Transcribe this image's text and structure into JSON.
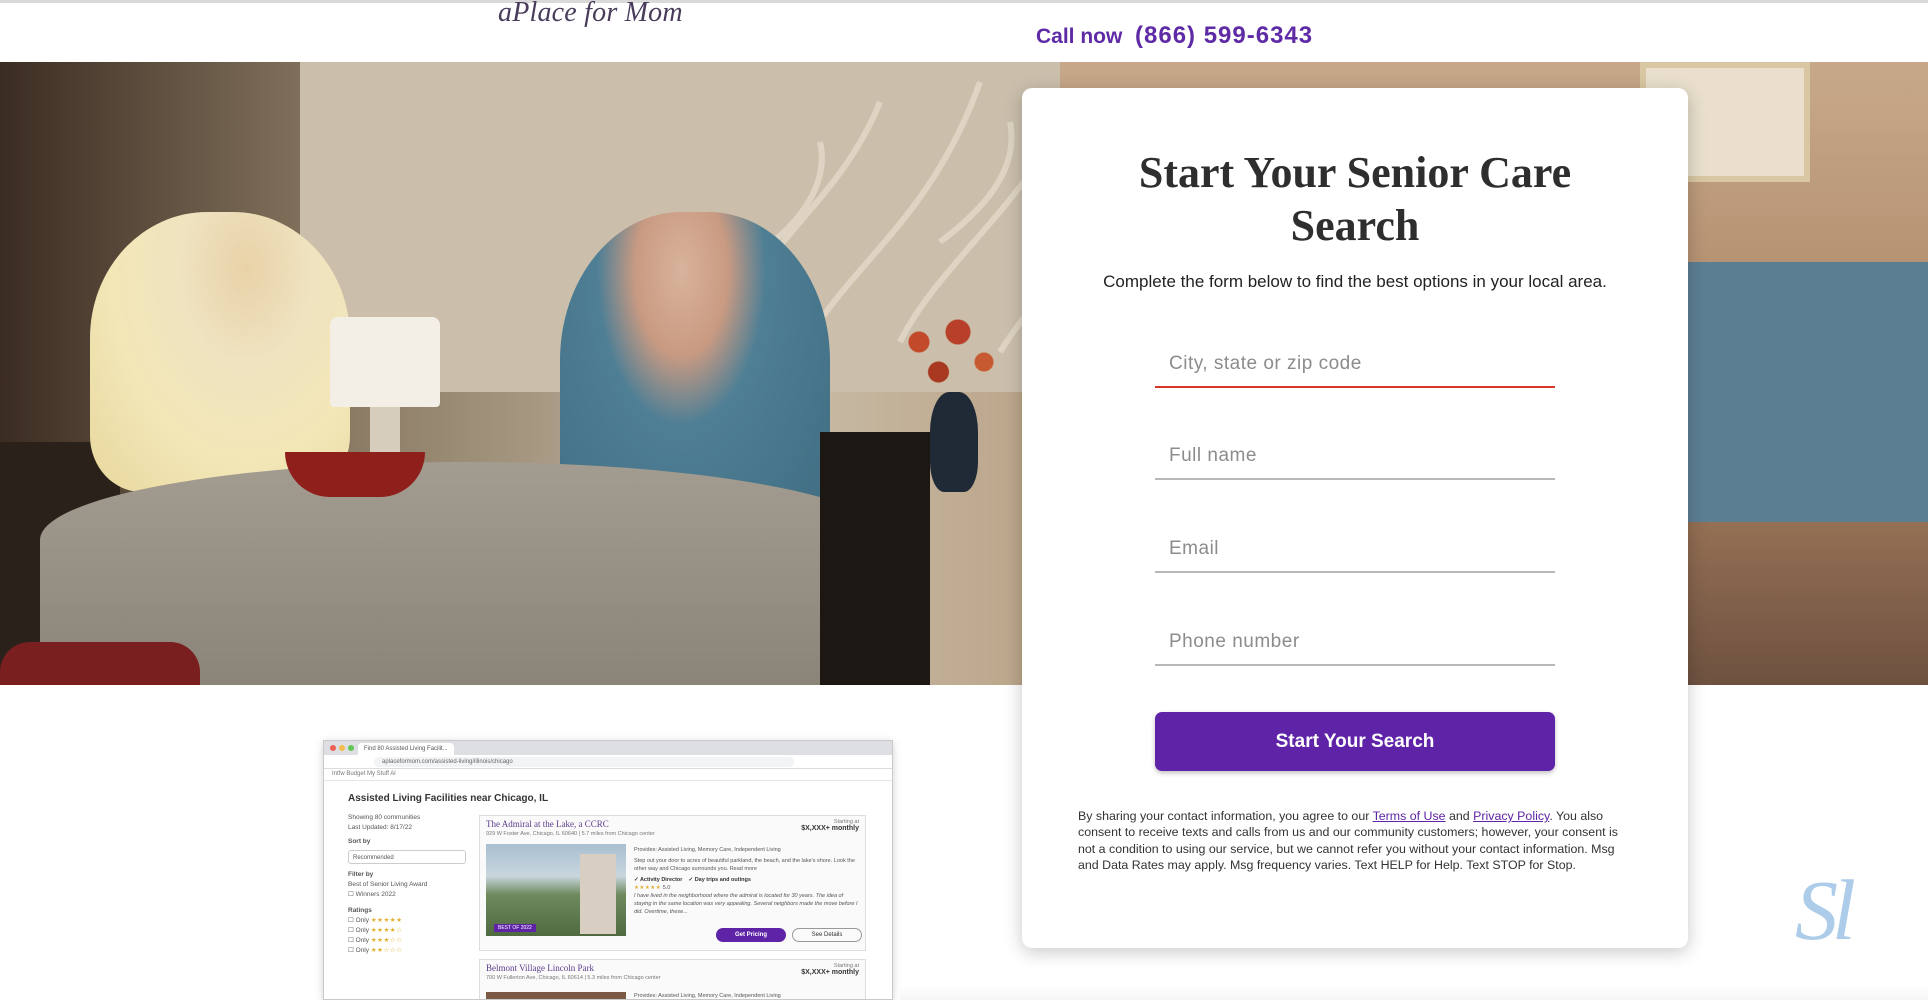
{
  "header": {
    "logo_text": "aPlace for Mom",
    "call_label": "Call now",
    "phone": "(866) 599-6343"
  },
  "form": {
    "title": "Start Your Senior Care Search",
    "subtitle": "Complete the form below to find the best options in your local area.",
    "location_placeholder": "City, state or zip code",
    "name_placeholder": "Full name",
    "email_placeholder": "Email",
    "phone_placeholder": "Phone number",
    "submit_label": "Start Your Search",
    "legal_prefix": "By sharing your contact information, you agree to our ",
    "terms_link": "Terms of Use",
    "legal_and": " and ",
    "privacy_link": "Privacy Policy",
    "legal_suffix": ". You also consent to receive texts and calls from us and our community customers; however, your consent is not a condition to using our service, but we cannot refer you without your contact information. Msg and Data Rates may apply. Msg frequency varies. Text HELP for Help. Text STOP for Stop.",
    "accent_color": "#5e23a6",
    "active_underline_color": "#d9362b"
  },
  "preview": {
    "tab_title": "Find 80 Assisted Living Facilit...",
    "url": "aplaceformom.com/assisted-living/illinois/chicago",
    "bookmarks": "Intfw   Budget   My Stuff   Al",
    "page_heading": "Assisted Living Facilities near Chicago, IL",
    "showing": "Showing 80 communities",
    "updated": "Last Updated: 8/17/22",
    "sort_label": "Sort by",
    "sort_value": "Recommended",
    "filter_label": "Filter by",
    "award_label": "Best of Senior Living Award",
    "award_option": "Winners 2022",
    "ratings_label": "Ratings",
    "rating_option": "Only",
    "listings": [
      {
        "name": "The Admiral at the Lake, a CCRC",
        "address": "929 W Foster Ave, Chicago, IL 60640 | 5.7 miles from Chicago center",
        "price_label": "Starting at",
        "price": "$X,XXX+ monthly",
        "provides": "Provides: Assisted Living, Memory Care, Independent Living",
        "blurb": "Step out your door to acres of beautiful parkland, the beach, and the lake's shore. Look the other way and Chicago surrounds you. Read more",
        "feature1": "Activity Director",
        "feature2": "Day trips and outings",
        "rating": "5.0",
        "quote": "I have lived in the neighborhood where the admiral is located for 30 years. The idea of staying in the same location was very appealing. Several neighbors made the move before I did. Overtime, these...",
        "badge": "BEST OF 2022",
        "btn_primary": "Get Pricing",
        "btn_secondary": "See Details"
      },
      {
        "name": "Belmont Village Lincoln Park",
        "address": "700 W Fullerton Ave, Chicago, IL 60614 | 5.3 miles from Chicago center",
        "price_label": "Starting at",
        "price": "$X,XXX+ monthly",
        "provides": "Provides: Assisted Living, Memory Care, Independent Living"
      }
    ]
  },
  "watermark": "Sl"
}
